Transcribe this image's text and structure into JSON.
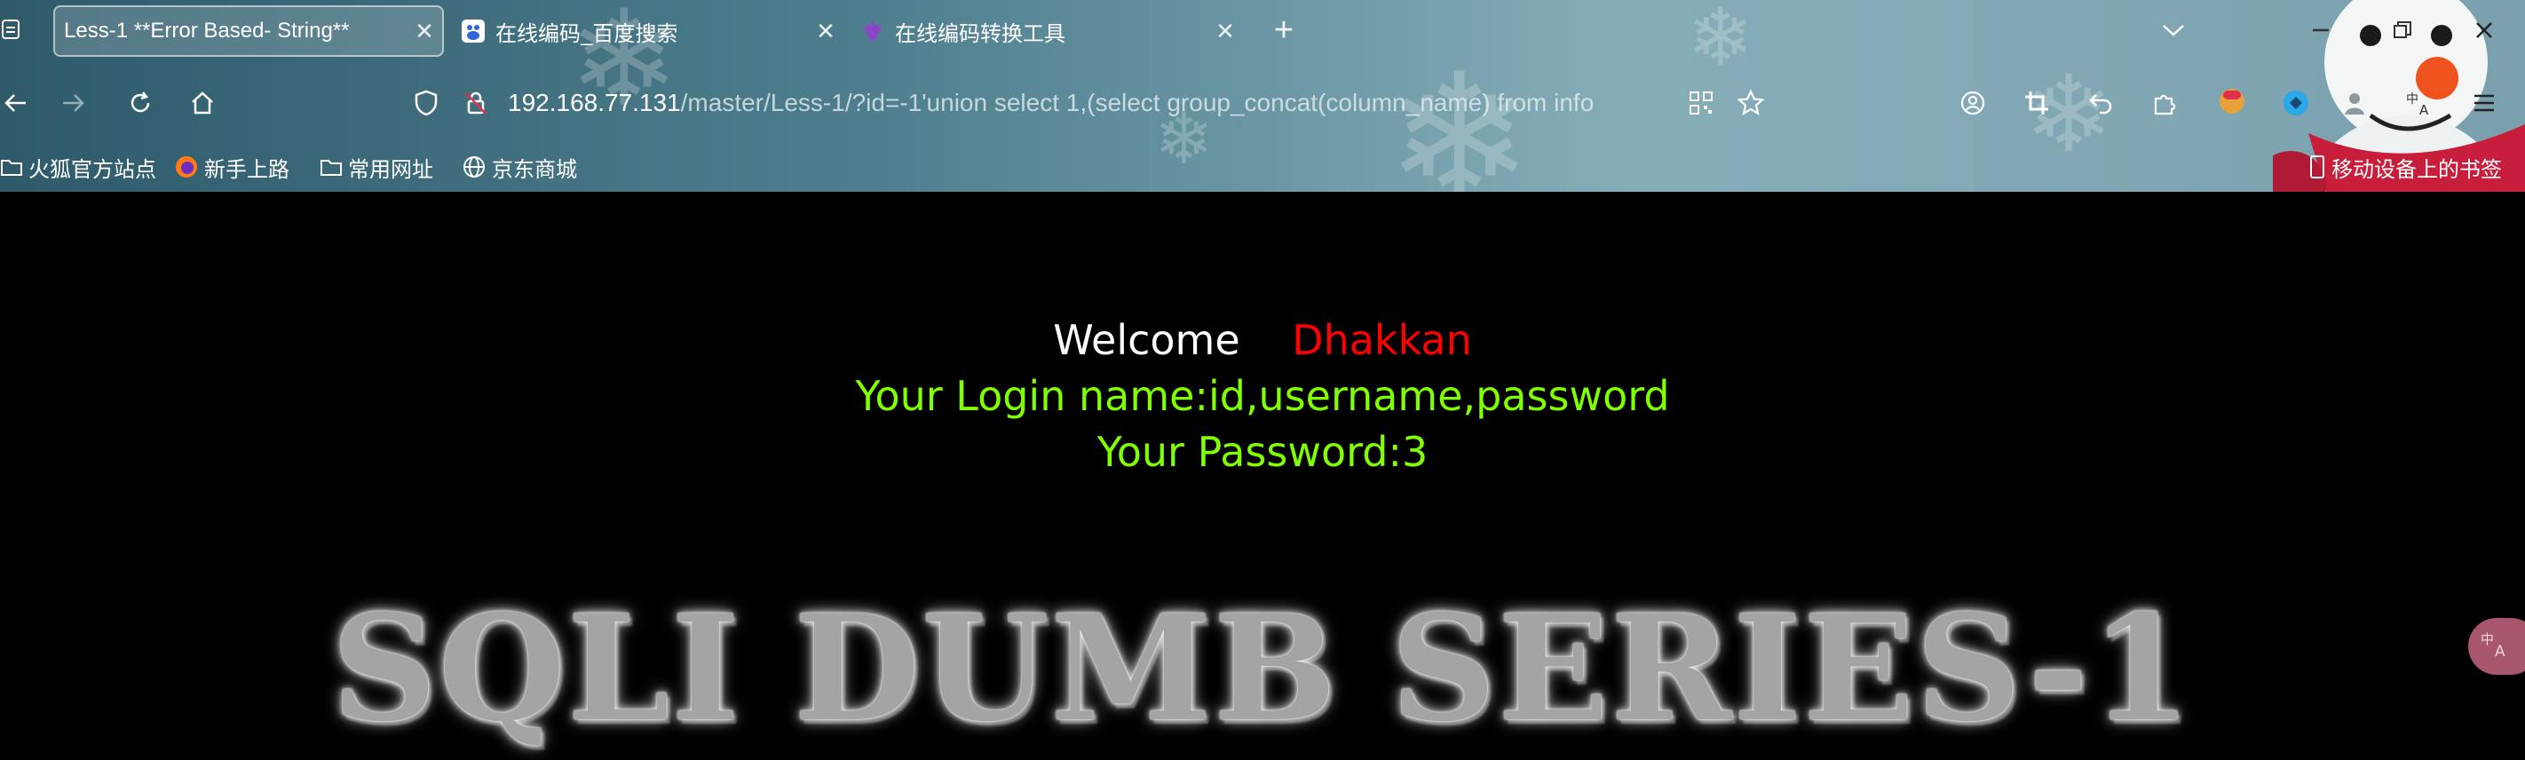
{
  "tabs": [
    {
      "label": "Less-1 **Error Based- String**",
      "active": true
    },
    {
      "label": "在线编码_百度搜索",
      "active": false
    },
    {
      "label": "在线编码转换工具",
      "active": false
    }
  ],
  "tab_close_glyph": "✕",
  "new_tab_glyph": "+",
  "url": {
    "host": "192.168.77.131",
    "path": "/master/Less-1/?id=-1'union select 1,(select group_concat(column_name) from info"
  },
  "bookmarks": [
    {
      "label": "火狐官方站点",
      "icon": "folder-icon"
    },
    {
      "label": "新手上路",
      "icon": "firefox-icon"
    },
    {
      "label": "常用网址",
      "icon": "folder-icon"
    },
    {
      "label": "京东商城",
      "icon": "globe-icon"
    }
  ],
  "mobile_bookmarks": "移动设备上的书签",
  "page": {
    "welcome": "Welcome",
    "user": "Dhakkan",
    "login_line": "Your Login name:id,username,password",
    "password_line": "Your Password:3",
    "banner": "SQLI DUMB SERIES-1"
  },
  "colors": {
    "welcome": "#ffffff",
    "user": "#ff0000",
    "info": "#80ff00",
    "background": "#000000"
  }
}
